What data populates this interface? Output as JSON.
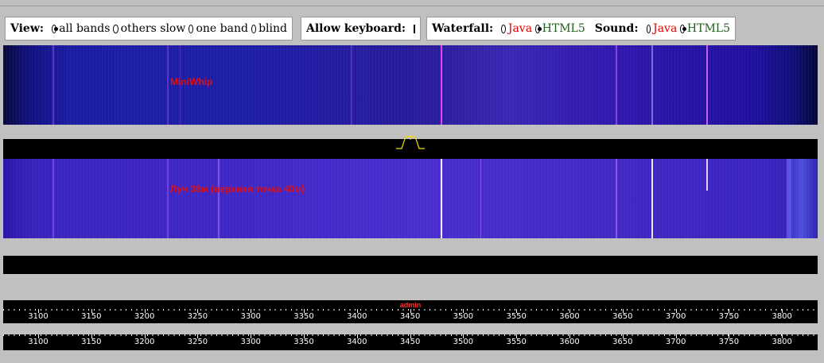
{
  "toolbar": {
    "view": {
      "label": "View:",
      "options": [
        {
          "label": "all bands",
          "selected": true
        },
        {
          "label": "others slow",
          "selected": false
        },
        {
          "label": "one band",
          "selected": false
        },
        {
          "label": "blind",
          "selected": false
        }
      ]
    },
    "keyboard": {
      "label": "Allow keyboard:",
      "checked": false
    },
    "waterfall": {
      "label": "Waterfall:",
      "options": [
        {
          "label": "Java",
          "selected": false
        },
        {
          "label": "HTML5",
          "selected": true
        }
      ]
    },
    "sound": {
      "label": "Sound:",
      "options": [
        {
          "label": "Java",
          "selected": false
        },
        {
          "label": "HTML5",
          "selected": true
        }
      ]
    }
  },
  "waterfalls": [
    {
      "label": "MiniWhip"
    },
    {
      "label": "Луч 38м (верхняя точка 40м)"
    }
  ],
  "scale_labels": [
    "3100",
    "3150",
    "3200",
    "3250",
    "3300",
    "3350",
    "3400",
    "3450",
    "3500",
    "3550",
    "3600",
    "3650",
    "3700",
    "3750",
    "3800"
  ],
  "tuned_frequency_khz": 3450,
  "user_label": "admin",
  "colors": {
    "label_red": "#e01010",
    "java_red": "#e00000",
    "html5_green": "#1f5f1f",
    "passband_yellow": "#f0e000",
    "background": "#c0c0c0"
  }
}
